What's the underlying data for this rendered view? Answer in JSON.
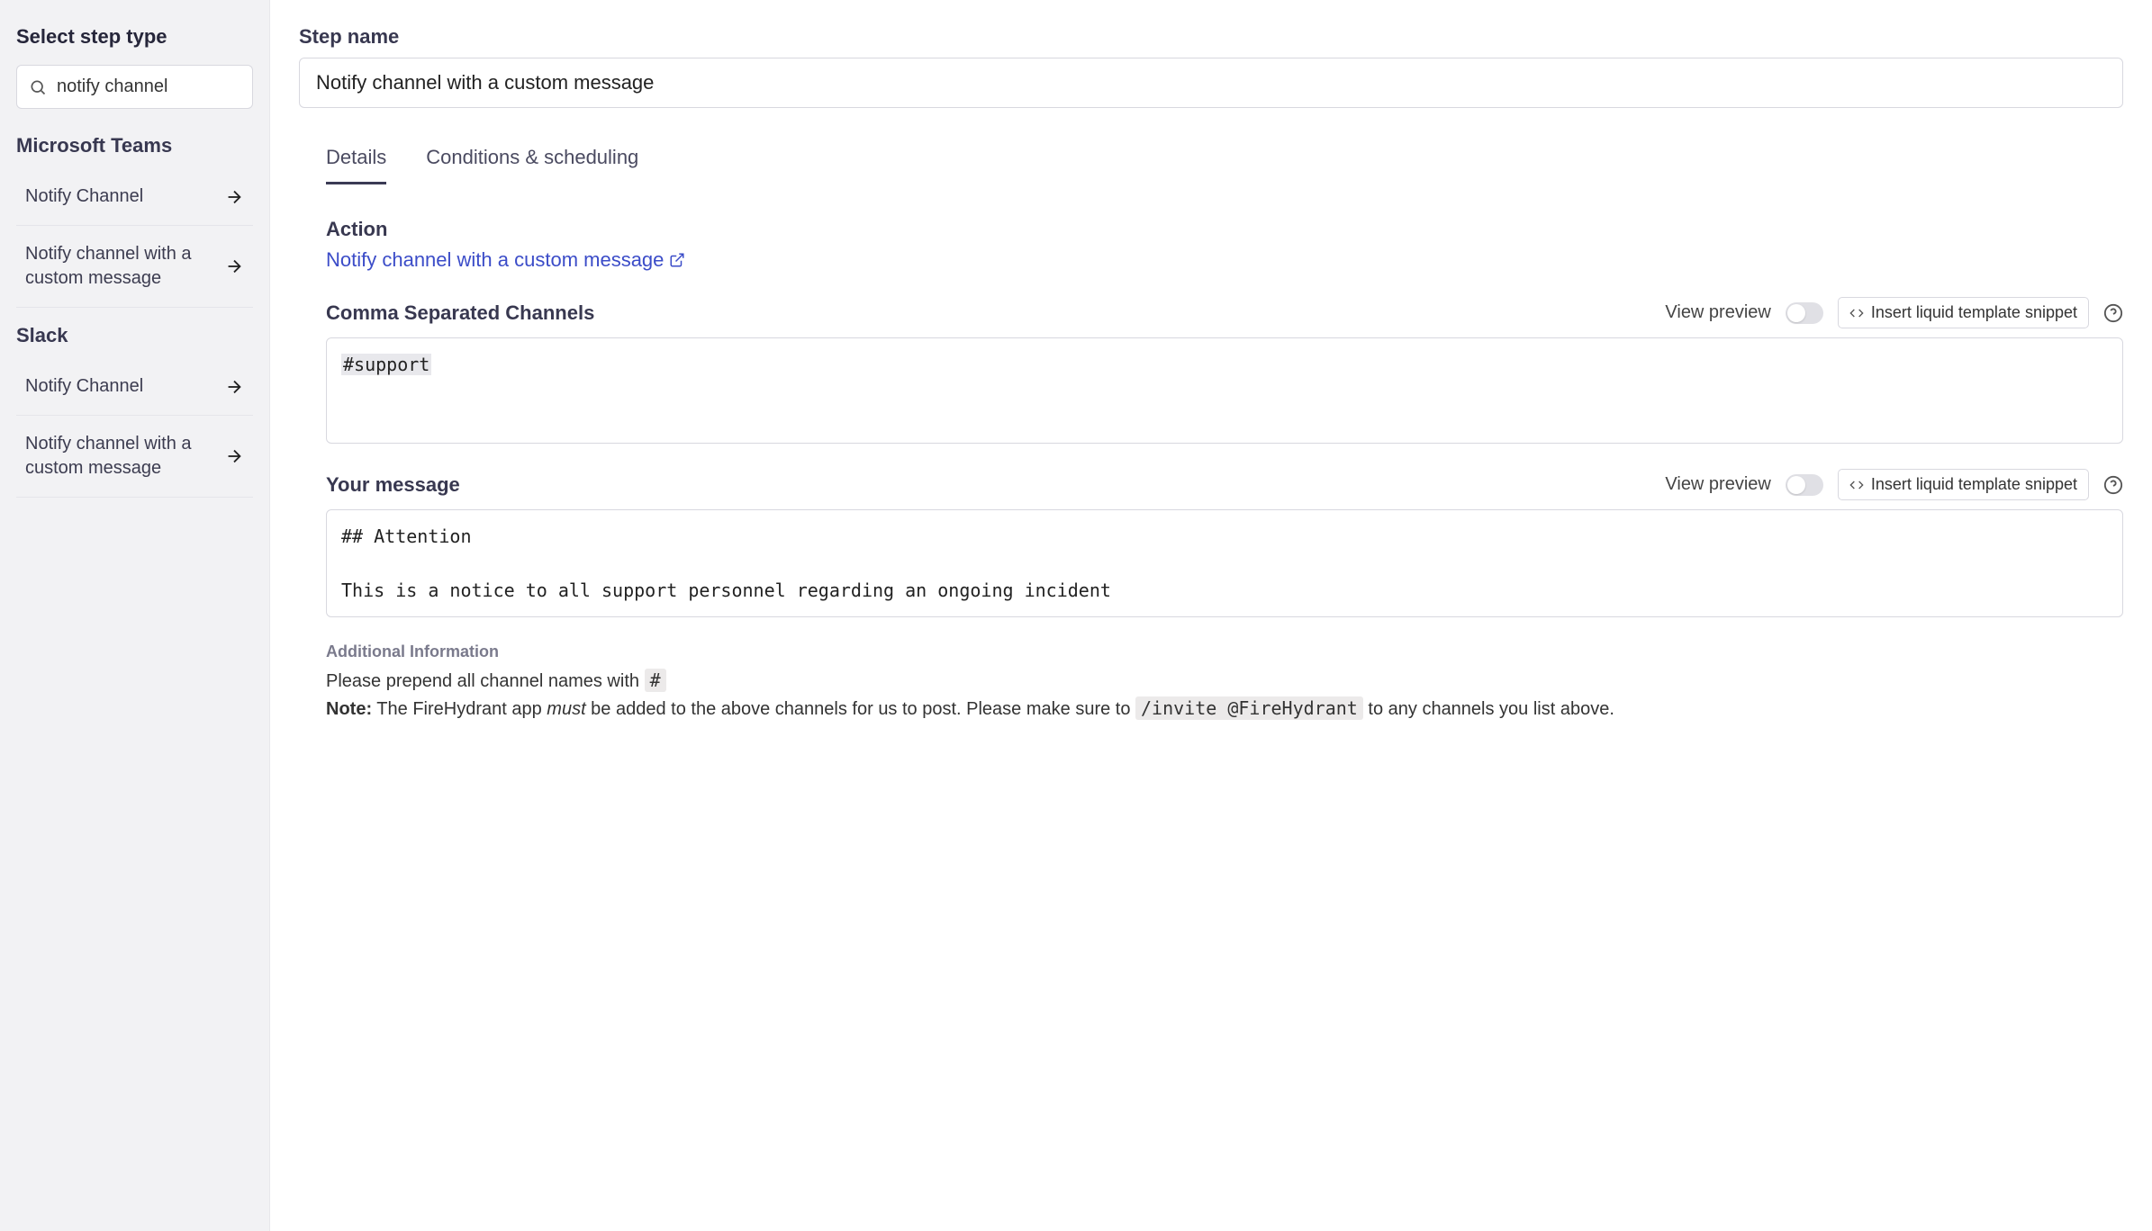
{
  "sidebar": {
    "title": "Select step type",
    "search": {
      "value": "notify channel"
    },
    "categories": [
      {
        "name": "Microsoft Teams",
        "items": [
          {
            "label": "Notify Channel"
          },
          {
            "label": "Notify channel with a custom message"
          }
        ]
      },
      {
        "name": "Slack",
        "items": [
          {
            "label": "Notify Channel"
          },
          {
            "label": "Notify channel with a custom message"
          }
        ]
      }
    ]
  },
  "main": {
    "step_name_label": "Step name",
    "step_name_value": "Notify channel with a custom message",
    "tabs": {
      "details": "Details",
      "conditions": "Conditions & scheduling",
      "active": "details"
    },
    "action": {
      "heading": "Action",
      "link": "Notify channel with a custom message"
    },
    "channels": {
      "heading": "Comma Separated Channels",
      "value": "#support"
    },
    "message": {
      "heading": "Your message",
      "value": "## Attention\n\nThis is a notice to all support personnel regarding an ongoing incident"
    },
    "tools": {
      "preview_label": "View preview",
      "snippet_label": "Insert liquid template snippet"
    },
    "additional": {
      "title": "Additional Information",
      "line1_pre": "Please prepend all channel names with ",
      "line1_code": "#",
      "line2_note": "Note:",
      "line2_pre": " The FireHydrant app ",
      "line2_em": "must",
      "line2_mid": " be added to the above channels for us to post. Please make sure to ",
      "line2_code": "/invite @FireHydrant",
      "line2_post": " to any channels you list above."
    }
  }
}
